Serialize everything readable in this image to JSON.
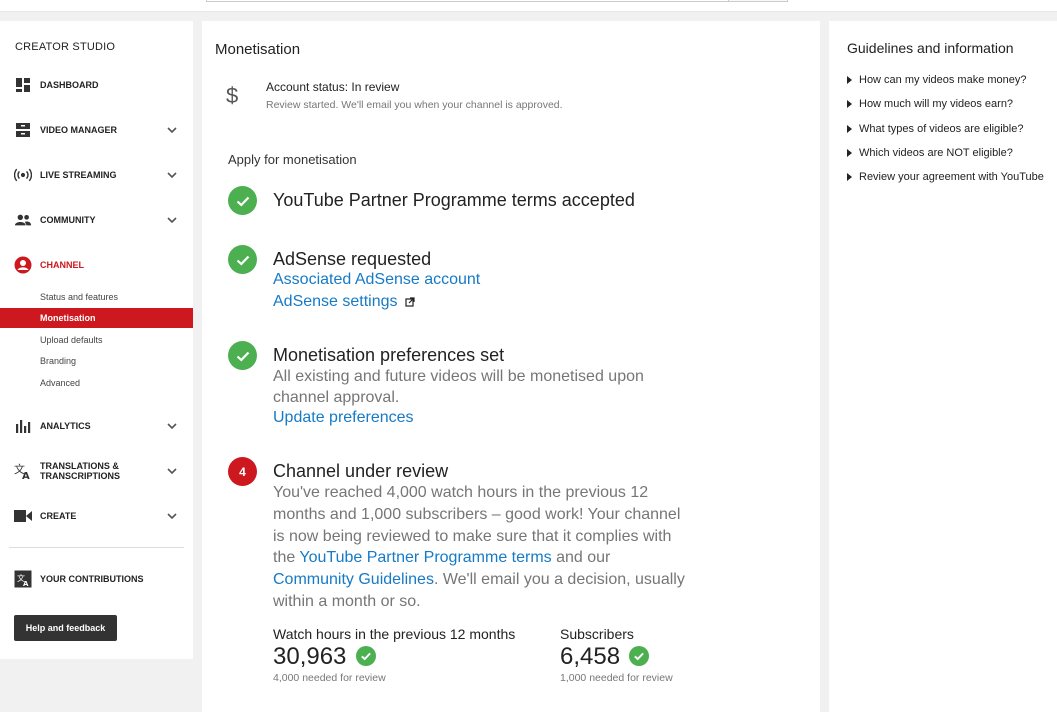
{
  "sidebar": {
    "title": "CREATOR STUDIO",
    "items": [
      {
        "label": "DASHBOARD",
        "icon": "dashboard-icon"
      },
      {
        "label": "VIDEO MANAGER",
        "icon": "video-manager-icon"
      },
      {
        "label": "LIVE STREAMING",
        "icon": "live-streaming-icon"
      },
      {
        "label": "COMMUNITY",
        "icon": "community-icon"
      },
      {
        "label": "CHANNEL",
        "icon": "channel-icon"
      },
      {
        "label": "ANALYTICS",
        "icon": "analytics-icon"
      },
      {
        "label": "TRANSLATIONS &",
        "label2": "TRANSCRIPTIONS",
        "icon": "translations-icon"
      },
      {
        "label": "CREATE",
        "icon": "create-icon"
      },
      {
        "label": "YOUR CONTRIBUTIONS",
        "icon": "contributions-icon"
      }
    ],
    "channel_sub": [
      {
        "label": "Status and features"
      },
      {
        "label": "Monetisation"
      },
      {
        "label": "Upload defaults"
      },
      {
        "label": "Branding"
      },
      {
        "label": "Advanced"
      }
    ],
    "help_label": "Help and feedback"
  },
  "main": {
    "title": "Monetisation",
    "account_status": "Account status: In review",
    "account_sub": "Review started. We'll email you when your channel is approved.",
    "apply_title": "Apply for monetisation",
    "steps": [
      {
        "head": "YouTube Partner Programme terms accepted"
      },
      {
        "head": "AdSense requested",
        "link1": "Associated AdSense account",
        "link2": "AdSense settings"
      },
      {
        "head": "Monetisation preferences set",
        "line1": "All existing and future videos will be monetised upon",
        "line2": "channel approval.",
        "link": "Update preferences"
      },
      {
        "number": "4",
        "head": "Channel under review",
        "l1": "You've reached 4,000 watch hours in the previous 12",
        "l2": "months and 1,000 subscribers – good work! Your channel",
        "l3": "is now being reviewed to make sure that it complies with",
        "l4a": "the ",
        "l4link": "YouTube Partner Programme terms",
        "l4b": " and our",
        "l5link": "Community Guidelines",
        "l5b": ". We'll email you a decision, usually",
        "l6": "within a month or so."
      }
    ],
    "stats": [
      {
        "label": "Watch hours in the previous 12 months",
        "value": "30,963",
        "sub": "4,000 needed for review"
      },
      {
        "label": "Subscribers",
        "value": "6,458",
        "sub": "1,000 needed for review"
      }
    ]
  },
  "right": {
    "title": "Guidelines and information",
    "items": [
      "How can my videos make money?",
      "How much will my videos earn?",
      "What types of videos are eligible?",
      "Which videos are NOT eligible?",
      "Review your agreement with YouTube"
    ]
  },
  "colors": {
    "accent_red": "#cc181e",
    "link_blue": "#167ac6",
    "check_green": "#4caf50"
  }
}
